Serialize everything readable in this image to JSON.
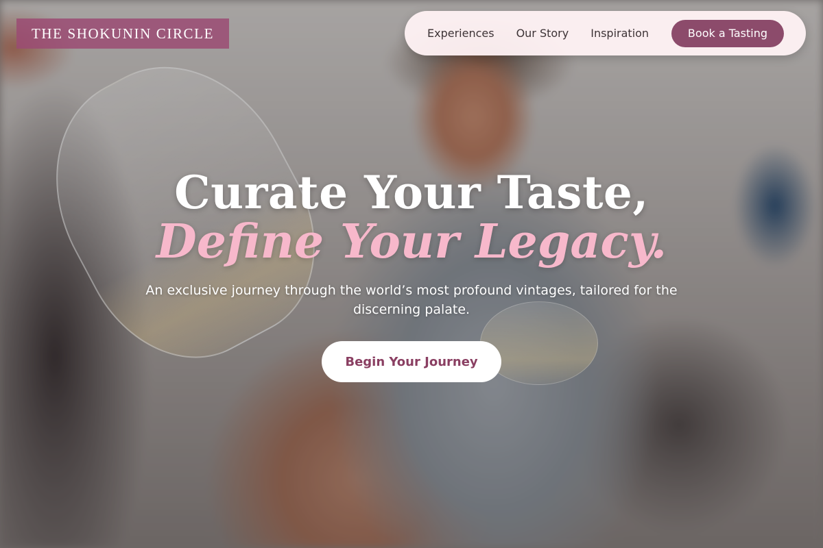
{
  "brand": {
    "name": "THE SHOKUNIN CIRCLE"
  },
  "nav": {
    "links": [
      "Experiences",
      "Our Story",
      "Inspiration"
    ],
    "cta_label": "Book a Tasting"
  },
  "hero": {
    "headline_line1": "Curate Your Taste,",
    "headline_line2": "Define Your Legacy.",
    "subtitle": "An exclusive journey through the world’s most profound vintages, tailored for the discerning palate.",
    "cta_label": "Begin Your Journey"
  },
  "colors": {
    "brand_bg": "#9b4b73",
    "nav_bg": "#fff2f4",
    "cta_accent": "#8c4b6b",
    "headline_accent": "#f7b8cb"
  }
}
